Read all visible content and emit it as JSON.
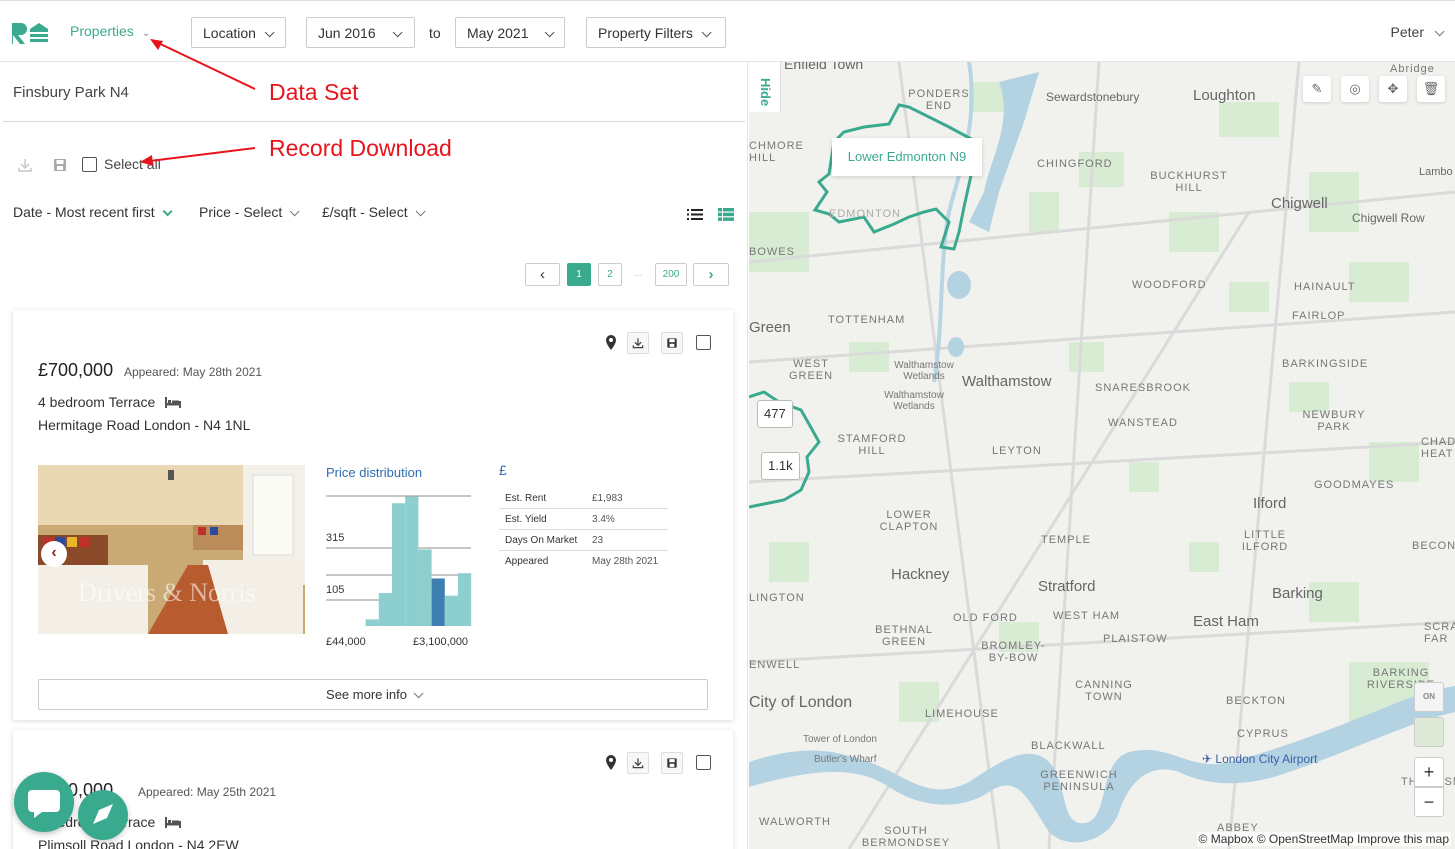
{
  "header": {
    "dataset_label": "Properties",
    "location_label": "Location",
    "date_from": "Jun 2016",
    "to_label": "to",
    "date_to": "May 2021",
    "filters_label": "Property Filters",
    "user_name": "Peter"
  },
  "annotations": {
    "data_set": "Data Set",
    "record_download": "Record Download"
  },
  "list": {
    "location_title": "Finsbury Park N4",
    "select_all_label": "Select all",
    "sort": {
      "date": "Date - Most recent first",
      "price": "Price - Select",
      "psqft": "£/sqft - Select"
    },
    "pagination": {
      "prev": "‹",
      "pages": [
        "1",
        "2"
      ],
      "dots": "...",
      "last": "200",
      "next": "›",
      "current": "1"
    },
    "listings": [
      {
        "price": "£700,000",
        "appeared": "Appeared: May 28th 2021",
        "type": "4 bedroom Terrace",
        "address": "Hermitage Road London - N4 1NL",
        "photo_watermark": "Drivers & Norris",
        "price_distribution_title": "Price distribution",
        "currency_symbol": "£",
        "hist_y_labels": [
          "315",
          "105"
        ],
        "hist_x_min": "£44,000",
        "hist_x_max": "£3,100,000",
        "stats": [
          {
            "key": "Est. Rent",
            "value": "£1,983"
          },
          {
            "key": "Est. Yield",
            "value": "3.4%"
          },
          {
            "key": "Days On Market",
            "value": "23"
          },
          {
            "key": "Appeared",
            "value": "May 28th 2021"
          }
        ],
        "see_more": "See more info"
      },
      {
        "price": "£500,000",
        "appeared": "Appeared: May 25th 2021",
        "type": "3 bedroom Terrace",
        "address": "Plimsoll Road London - N4 2EW"
      }
    ]
  },
  "map": {
    "hide_label": "Hide",
    "area_label": "Lower Edmonton N9",
    "clusters": [
      "477",
      "1.1k"
    ],
    "airport_label": "London City Airport",
    "attribution": "© Mapbox © OpenStreetMap Improve this map",
    "toggle_label": "ON",
    "labels": [
      {
        "text": "Enfield Town",
        "cls": "md"
      },
      {
        "text": "PONDERS END",
        "cls": "sm"
      },
      {
        "text": "Sewardstonebury",
        "cls": "md"
      },
      {
        "text": "Loughton",
        "cls": "lg"
      },
      {
        "text": "Abridge",
        "cls": "sm"
      },
      {
        "text": "CHMORE HILL",
        "cls": "sm"
      },
      {
        "text": "CHINGFORD",
        "cls": "sm"
      },
      {
        "text": "BUCKHURST HILL",
        "cls": "sm"
      },
      {
        "text": "Lambo",
        "cls": "md"
      },
      {
        "text": "Chigwell",
        "cls": "lg"
      },
      {
        "text": "Chigwell Row",
        "cls": "md"
      },
      {
        "text": "EDMONTON",
        "cls": "sm"
      },
      {
        "text": "BOWES",
        "cls": "sm"
      },
      {
        "text": "WOODFORD",
        "cls": "sm"
      },
      {
        "text": "HAINAULT",
        "cls": "sm"
      },
      {
        "text": "Green",
        "cls": "lg"
      },
      {
        "text": "TOTTENHAM",
        "cls": "sm"
      },
      {
        "text": "FAIRLOP",
        "cls": "sm"
      },
      {
        "text": "WEST GREEN",
        "cls": "sm"
      },
      {
        "text": "Walthamstow Wetlands",
        "cls": "sm"
      },
      {
        "text": "Walthamstow",
        "cls": "lg"
      },
      {
        "text": "SNARESBROOK",
        "cls": "sm"
      },
      {
        "text": "BARKINGSIDE",
        "cls": "sm"
      },
      {
        "text": "Walthamstow Wetlands",
        "cls": "sm"
      },
      {
        "text": "WANSTEAD",
        "cls": "sm"
      },
      {
        "text": "NEWBURY PARK",
        "cls": "sm"
      },
      {
        "text": "STAMFORD HILL",
        "cls": "sm"
      },
      {
        "text": "LEYTON",
        "cls": "sm"
      },
      {
        "text": "CHADW HEAT",
        "cls": "sm"
      },
      {
        "text": "GOODMAYES",
        "cls": "sm"
      },
      {
        "text": "Ilford",
        "cls": "lg"
      },
      {
        "text": "LOWER CLAPTON",
        "cls": "sm"
      },
      {
        "text": "TEMPLE",
        "cls": "sm"
      },
      {
        "text": "LITTLE ILFORD",
        "cls": "sm"
      },
      {
        "text": "BECONT",
        "cls": "sm"
      },
      {
        "text": "Hackney",
        "cls": "lg"
      },
      {
        "text": "Stratford",
        "cls": "lg"
      },
      {
        "text": "LINGTON",
        "cls": "sm"
      },
      {
        "text": "Barking",
        "cls": "lg"
      },
      {
        "text": "WEST HAM",
        "cls": "sm"
      },
      {
        "text": "BETHNAL GREEN",
        "cls": "sm"
      },
      {
        "text": "OLD FORD",
        "cls": "sm"
      },
      {
        "text": "PLAISTOW",
        "cls": "sm"
      },
      {
        "text": "East Ham",
        "cls": "lg"
      },
      {
        "text": "SCRAT FAR",
        "cls": "sm"
      },
      {
        "text": "BROMLEY-BY-BOW",
        "cls": "sm"
      },
      {
        "text": "ENWELL",
        "cls": "sm"
      },
      {
        "text": "BARKING RIVERSIDE",
        "cls": "sm"
      },
      {
        "text": "CANNING TOWN",
        "cls": "sm"
      },
      {
        "text": "City of London",
        "cls": "lg"
      },
      {
        "text": "BECKTON",
        "cls": "sm"
      },
      {
        "text": "LIMEHOUSE",
        "cls": "sm"
      },
      {
        "text": "Tower of London",
        "cls": "sm"
      },
      {
        "text": "CYPRUS",
        "cls": "sm"
      },
      {
        "text": "BLACKWALL",
        "cls": "sm"
      },
      {
        "text": "Butler's Wharf",
        "cls": "sm"
      },
      {
        "text": "THAMESM",
        "cls": "sm"
      },
      {
        "text": "GREENWICH PENINSULA",
        "cls": "sm"
      },
      {
        "text": "WALWORTH",
        "cls": "sm"
      },
      {
        "text": "SOUTH BERMONDSEY",
        "cls": "sm"
      },
      {
        "text": "ABBEY",
        "cls": "sm"
      }
    ]
  },
  "colors": {
    "brand": "#3aaa8f",
    "link_blue": "#2e6db4",
    "annotation_red": "#e8141c",
    "hist_bar": "#8dcfcf",
    "hist_highlight": "#3d7fb0"
  },
  "icons": [
    "logo-icon",
    "download-icon",
    "save-icon",
    "pin-icon",
    "bed-icon",
    "list-view-icon",
    "table-view-icon",
    "pencil-icon",
    "target-icon",
    "move-icon",
    "trash-icon",
    "chat-icon",
    "airplane-icon"
  ],
  "histogram": {
    "bars": [
      0,
      0,
      0,
      0.05,
      0.25,
      0.93,
      0.98,
      0.58,
      0.36,
      0.23,
      0.4
    ],
    "highlight_index": 8
  }
}
